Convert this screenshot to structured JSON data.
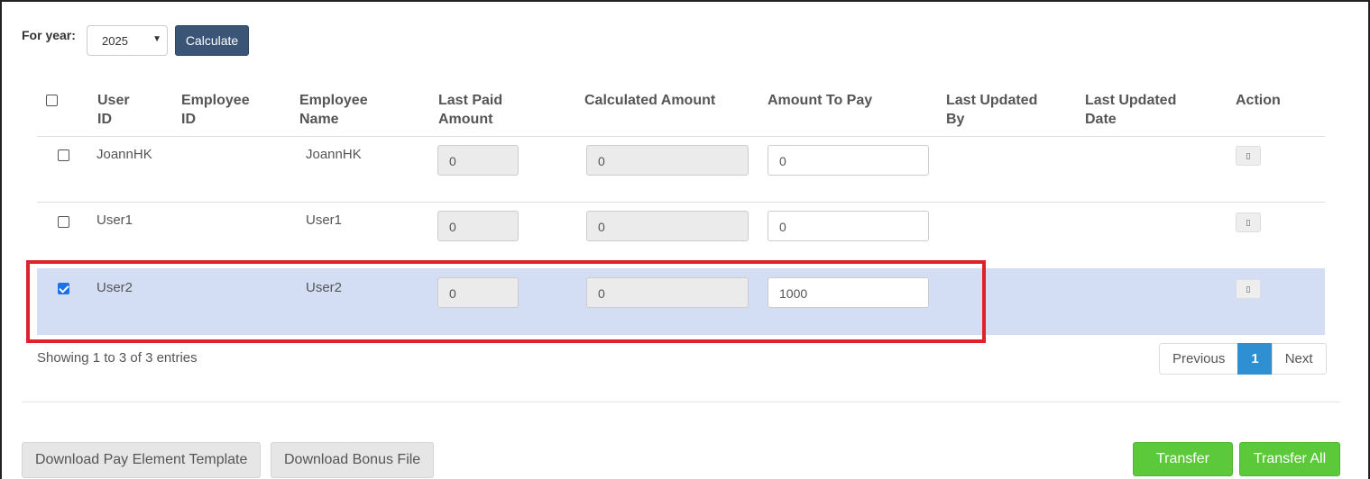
{
  "filter": {
    "year_label": "For year:",
    "year_value": "2025",
    "calculate_label": "Calculate"
  },
  "table": {
    "headers": {
      "user_id": [
        "User",
        "ID"
      ],
      "employee_id": [
        "Employee",
        "ID"
      ],
      "employee_name": [
        "Employee",
        "Name"
      ],
      "last_paid": [
        "Last Paid",
        "Amount"
      ],
      "calculated": "Calculated Amount",
      "amount_to_pay": "Amount To Pay",
      "last_updated_by": [
        "Last Updated",
        "By"
      ],
      "last_updated_date": [
        "Last Updated",
        "Date"
      ],
      "action": "Action"
    },
    "rows": [
      {
        "checked": false,
        "user_id": "JoannHK",
        "employee_id": "",
        "employee_name": "JoannHK",
        "last_paid": "0",
        "calculated": "0",
        "amount_to_pay": "0",
        "last_updated_by": "",
        "last_updated_date": "",
        "action_icon": "▯"
      },
      {
        "checked": false,
        "user_id": "User1",
        "employee_id": "",
        "employee_name": "User1",
        "last_paid": "0",
        "calculated": "0",
        "amount_to_pay": "0",
        "last_updated_by": "",
        "last_updated_date": "",
        "action_icon": "▯"
      },
      {
        "checked": true,
        "user_id": "User2",
        "employee_id": "",
        "employee_name": "User2",
        "last_paid": "0",
        "calculated": "0",
        "amount_to_pay": "1000",
        "last_updated_by": "",
        "last_updated_date": "",
        "action_icon": "▯"
      }
    ]
  },
  "footer": {
    "showing": "Showing 1 to 3 of 3 entries",
    "prev_label": "Previous",
    "page": "1",
    "next_label": "Next"
  },
  "actions": {
    "download_template": "Download Pay Element Template",
    "download_bonus": "Download Bonus File",
    "transfer": "Transfer",
    "transfer_all": "Transfer All"
  },
  "colors": {
    "calculate_bg": "#3b5576",
    "selected_row_bg": "#d3def5",
    "highlight_border": "#e0202a",
    "transfer_bg": "#5cc93b",
    "pager_active": "#2f8fd3"
  }
}
